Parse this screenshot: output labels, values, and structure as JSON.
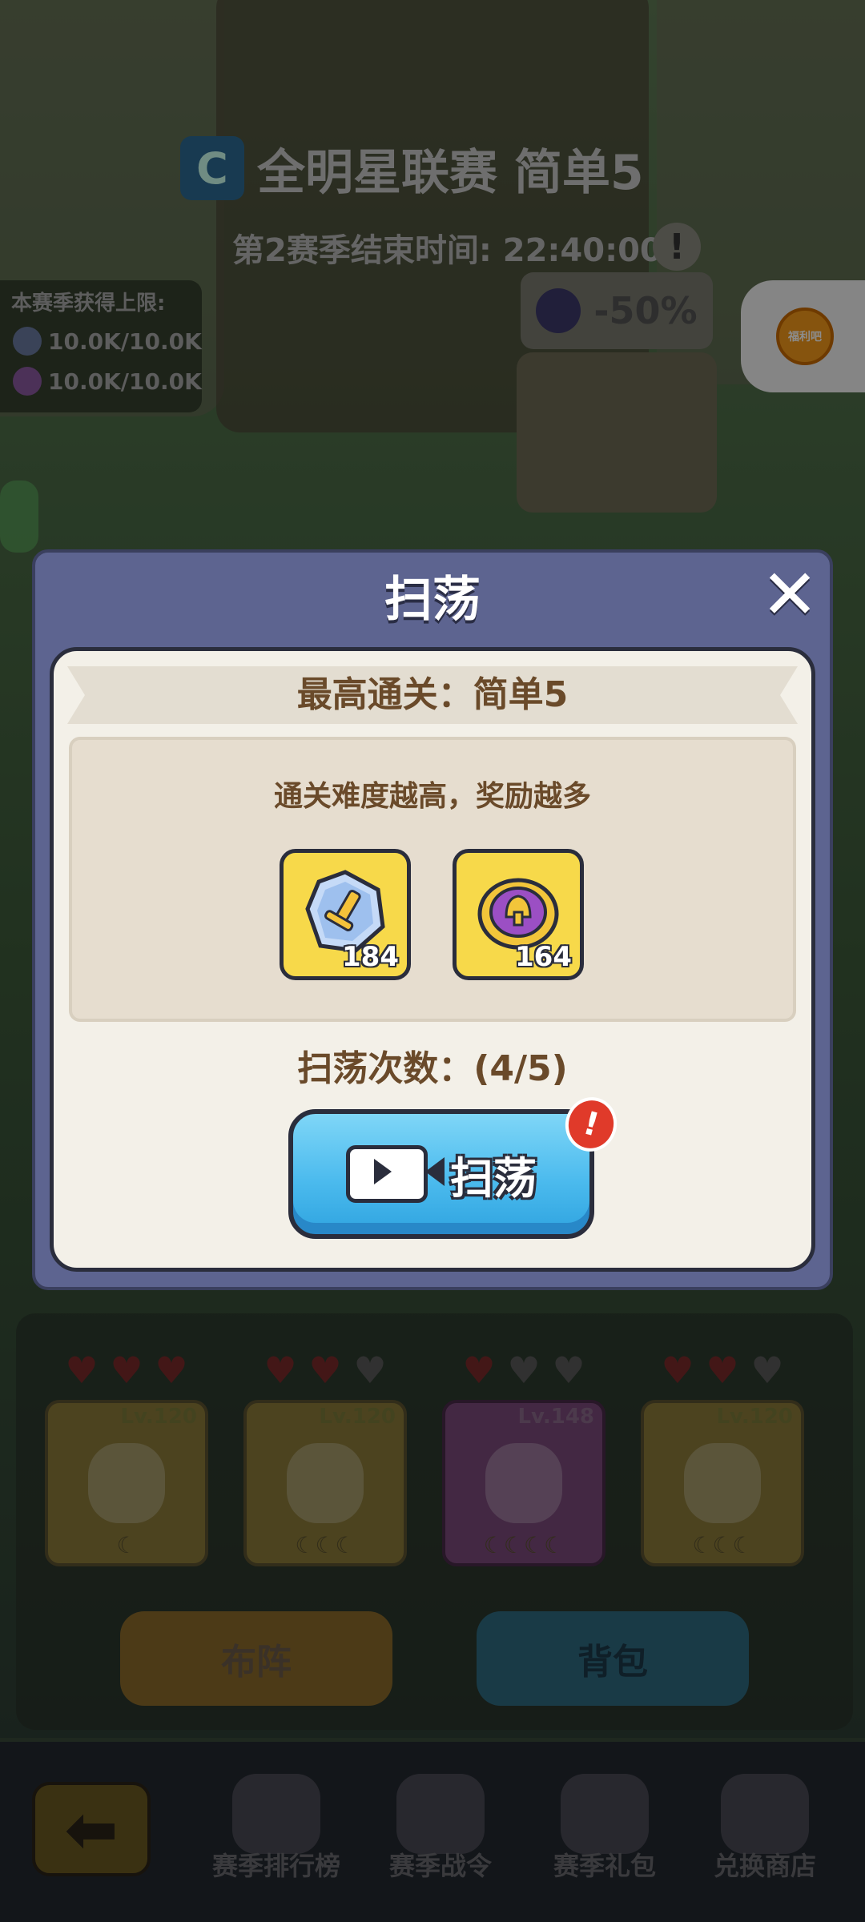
{
  "background": {
    "league_title": "全明星联赛  简单5",
    "season_end": "第2赛季结束时间: 22:40:00",
    "limits": {
      "header": "本赛季获得上限:",
      "row1": "10.0K/10.0K",
      "row2": "10.0K/10.0K"
    },
    "discount": "-50%",
    "side_button_label": "福利吧",
    "team": [
      {
        "level": "Lv.120",
        "stars": "☾",
        "hearts": [
          true,
          true,
          true
        ]
      },
      {
        "level": "Lv.120",
        "stars": "☾☾☾",
        "hearts": [
          true,
          true,
          false
        ]
      },
      {
        "level": "Lv.148",
        "stars": "☾☾☾☾",
        "hearts": [
          true,
          false,
          false
        ]
      },
      {
        "level": "Lv.120",
        "stars": "☾☾☾",
        "hearts": [
          true,
          true,
          false
        ]
      }
    ],
    "formation_button": "布阵",
    "bag_button": "背包"
  },
  "nav": {
    "back_icon": "arrow-left-icon",
    "items": [
      {
        "label": "赛季排行榜"
      },
      {
        "label": "赛季战令"
      },
      {
        "label": "赛季礼包"
      },
      {
        "label": "兑换商店"
      }
    ]
  },
  "modal": {
    "title": "扫荡",
    "close_icon": "close-icon",
    "highest_clear": "最高通关：简单5",
    "tip": "通关难度越高，奖励越多",
    "rewards": [
      {
        "icon": "sword-crystal-icon",
        "count": "184",
        "color": "#aec8f0"
      },
      {
        "icon": "helmet-medal-icon",
        "count": "164",
        "color": "#9b4fc4"
      }
    ],
    "sweep_count": "扫荡次数：(4/5)",
    "sweep_button": "扫荡",
    "badge": "!"
  }
}
